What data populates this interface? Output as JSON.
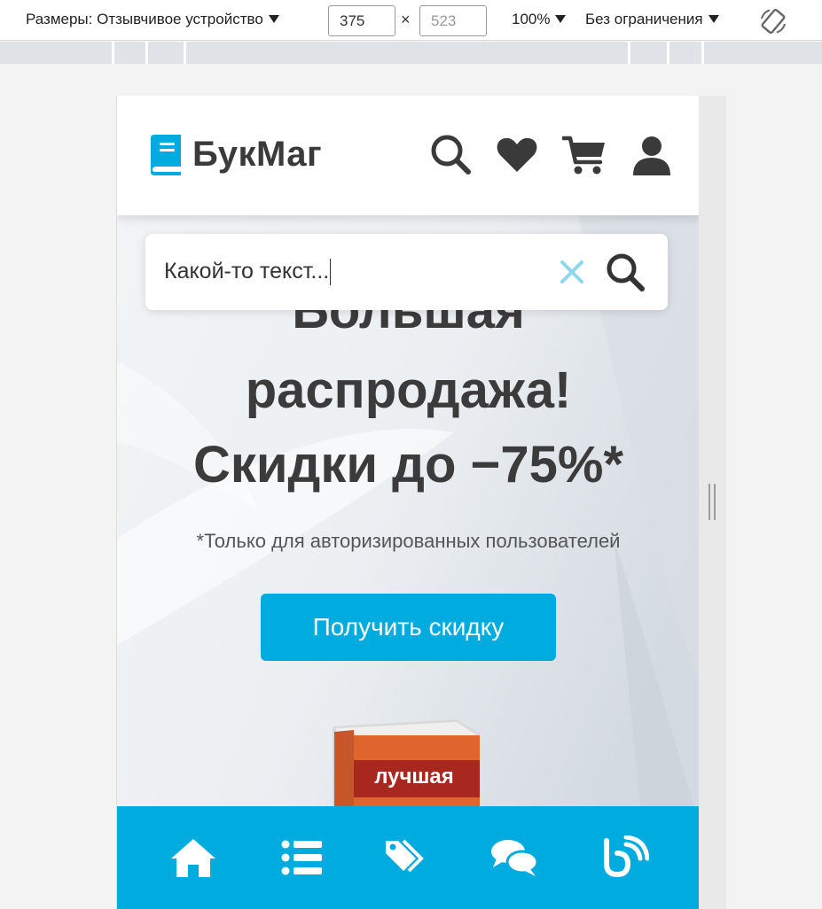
{
  "devtools": {
    "dimensions_label": "Размеры: Отзывчивое устройство",
    "width_value": "375",
    "height_placeholder": "523",
    "times_sign": "×",
    "zoom": "100%",
    "throttling": "Без ограничения"
  },
  "site": {
    "logo_text": "БукМаг",
    "header_icons": [
      "search-icon",
      "heart-icon",
      "cart-icon",
      "user-icon"
    ],
    "search": {
      "value": "Какой-то текст..."
    },
    "promo": {
      "title_line1": "Большая",
      "title_line2": "распродажа!",
      "title_line3": "Скидки до −75%*",
      "note": "*Только для авторизированных пользователей",
      "button_label": "Получить скидку"
    },
    "book_cover_text": "лучшая",
    "bottom_nav_icons": [
      "home-icon",
      "list-icon",
      "tags-icon",
      "comments-icon",
      "blog-icon"
    ]
  },
  "colors": {
    "accent": "#00acdf",
    "text_dark": "#3b3b3b",
    "clear_icon": "#8fd8ec"
  }
}
